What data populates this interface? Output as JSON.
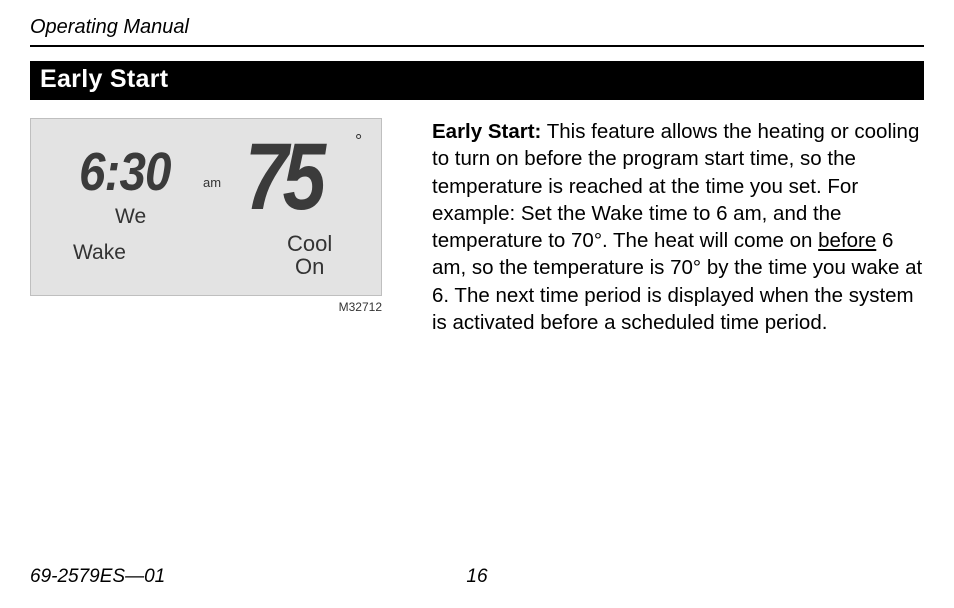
{
  "running_head": "Operating Manual",
  "section_title": "Early Start",
  "lcd": {
    "time": "6:30",
    "ampm": "am",
    "day": "We",
    "period": "Wake",
    "temp": "75",
    "degree": "°",
    "mode_line1": "Cool",
    "mode_line2": "On"
  },
  "figure_code": "M32712",
  "body": {
    "lead": "Early Start:",
    "p1a": " This feature allows the heating or cooling to turn on before the program start time, so the temperature is reached at the time you set. For example: Set the Wake time to 6 am, and the temperature to 70°. The heat will come on ",
    "underline": "before",
    "p1b": " 6 am, so the temperature is 70° by the time you wake at 6. The next time period is displayed when the system is activated before a scheduled time period."
  },
  "footer": {
    "doc_number": "69-2579ES—01",
    "page_number": "16"
  }
}
